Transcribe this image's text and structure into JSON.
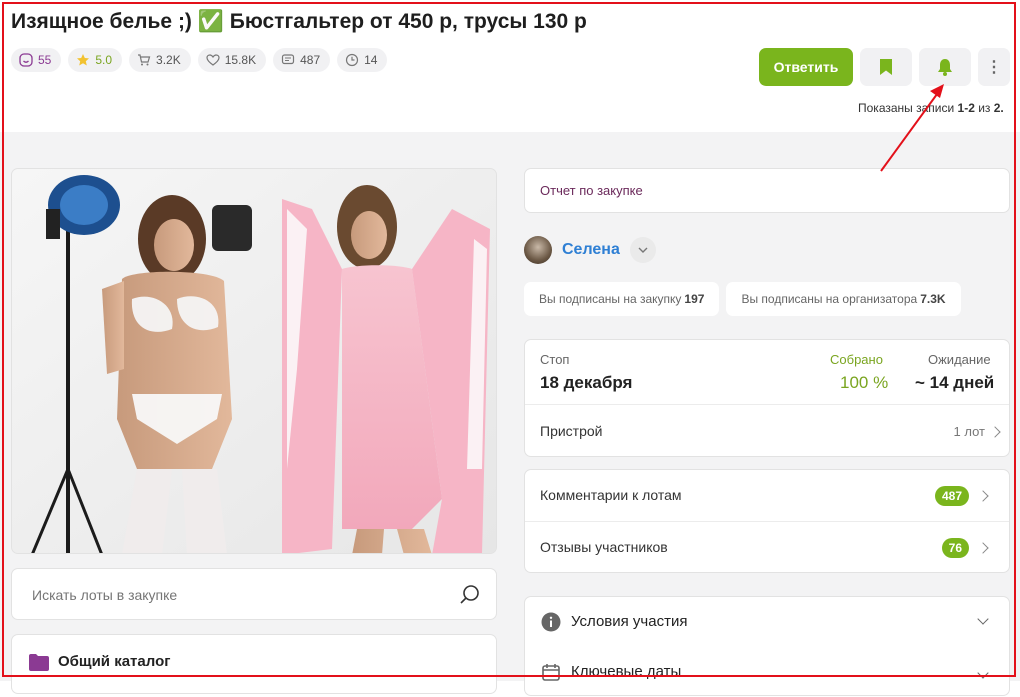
{
  "header": {
    "title": "Изящное белье ;) ✅ Бюстгальтер от 450 р, трусы 130 р",
    "stats": [
      {
        "icon": "smile-icon",
        "value": "55",
        "color": "#8b3a93"
      },
      {
        "icon": "star-icon",
        "value": "5.0",
        "color": "#7aa520"
      },
      {
        "icon": "cart-icon",
        "value": "3.2K"
      },
      {
        "icon": "heart-icon",
        "value": "15.8K"
      },
      {
        "icon": "comment-icon",
        "value": "487"
      },
      {
        "icon": "clock-icon",
        "value": "14"
      }
    ],
    "reply_label": "Ответить",
    "shown_prefix": "Показаны записи ",
    "shown_range": "1-2",
    "shown_mid": " из ",
    "shown_total": "2."
  },
  "search": {
    "placeholder": "Искать лоты в закупке"
  },
  "catalog": {
    "label": "Общий каталог"
  },
  "report": {
    "label": "Отчет по закупке"
  },
  "organizer": {
    "name": "Селена"
  },
  "subscriptions": [
    {
      "label": "Вы подписаны на закупку",
      "value": "197"
    },
    {
      "label": "Вы подписаны на организатора",
      "value": "7.3K"
    }
  ],
  "status": {
    "stop_label": "Стоп",
    "stop_value": "18 декабря",
    "collected_label": "Собрано",
    "collected_value": "100 %",
    "wait_label": "Ожидание",
    "wait_value": "~ 14 дней",
    "row_label": "Пристрой",
    "row_value": "1 лот"
  },
  "links": [
    {
      "label": "Комментарии к лотам",
      "badge": "487"
    },
    {
      "label": "Отзывы участников",
      "badge": "76"
    }
  ],
  "accordion": [
    {
      "label": "Условия участия",
      "icon": "info-icon"
    },
    {
      "label": "Ключевые даты",
      "icon": "calendar-icon"
    }
  ],
  "colors": {
    "accent": "#7ab51d",
    "link": "#2e7fd4",
    "annotation": "#e3101a"
  }
}
